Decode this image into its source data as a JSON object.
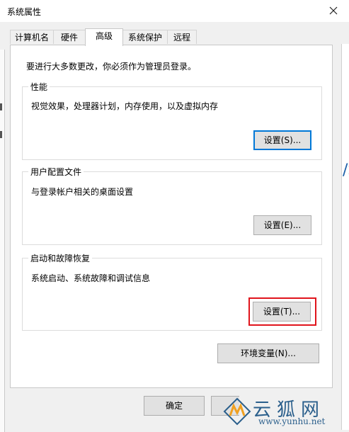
{
  "window": {
    "title": "系统属性"
  },
  "tabs": [
    {
      "label": "计算机名"
    },
    {
      "label": "硬件"
    },
    {
      "label": "高级",
      "active": true
    },
    {
      "label": "系统保护"
    },
    {
      "label": "远程"
    }
  ],
  "main": {
    "intro": "要进行大多数更改，你必须作为管理员登录。",
    "performance": {
      "title": "性能",
      "description": "视觉效果，处理器计划，内存使用，以及虚拟内存",
      "button": "设置(S)..."
    },
    "user_profiles": {
      "title": "用户配置文件",
      "description": "与登录帐户相关的桌面设置",
      "button": "设置(E)..."
    },
    "startup_recovery": {
      "title": "启动和故障恢复",
      "description": "系统启动、系统故障和调试信息",
      "button": "设置(T)..."
    },
    "env_button": "环境变量(N)..."
  },
  "footer": {
    "ok": "确定"
  },
  "background_peek": {
    "right_text": "/S"
  },
  "watermark": {
    "name": "云狐网",
    "url": "www.yunhu.net"
  },
  "colors": {
    "highlight": "#e0141c",
    "focus": "#0078d7",
    "watermark": "#2b5f8c"
  }
}
